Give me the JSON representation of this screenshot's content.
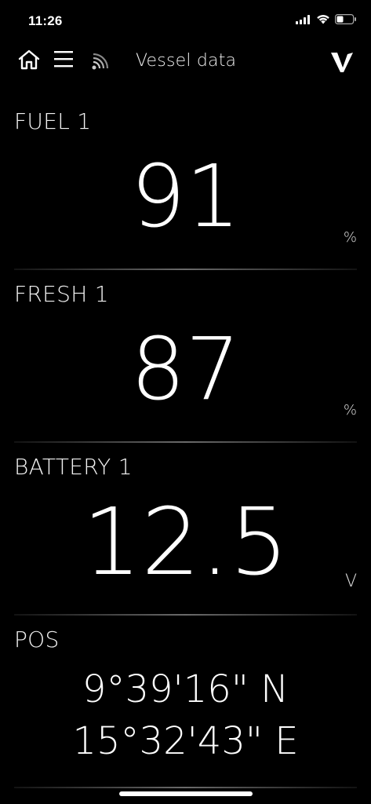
{
  "status_bar": {
    "time": "11:26",
    "icons": [
      "cellular-signal-icon",
      "wifi-icon",
      "battery-icon"
    ]
  },
  "header": {
    "title": "Vessel data",
    "icons": [
      "home-icon",
      "menu-icon",
      "signal-feed-icon",
      "brand-logo-icon"
    ]
  },
  "sections": {
    "fuel": {
      "label": "FUEL 1",
      "value": "91",
      "unit": "%"
    },
    "fresh": {
      "label": "FRESH 1",
      "value": "87",
      "unit": "%"
    },
    "battery": {
      "label": "BATTERY 1",
      "value": "12.5",
      "unit": "V"
    },
    "pos": {
      "label": "POS",
      "lat": "9°39'16\" N",
      "lon": "15°32'43\" E"
    }
  },
  "colors": {
    "background": "#000000",
    "text": "#ffffff",
    "divider": "#6a6a6a"
  }
}
